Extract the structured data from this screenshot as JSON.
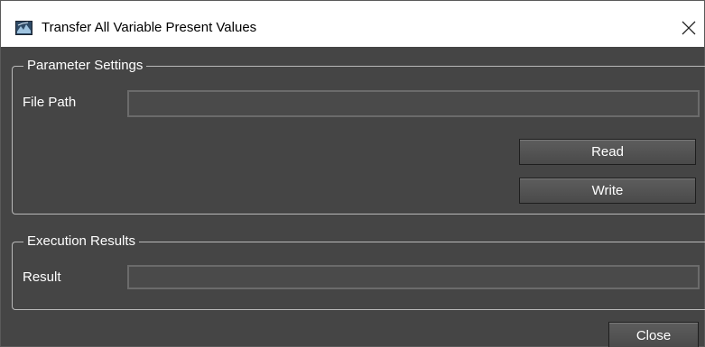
{
  "window": {
    "title": "Transfer All Variable Present Values",
    "icon": "app-icon",
    "close_icon": "close-icon"
  },
  "parameter_settings": {
    "legend": "Parameter Settings",
    "file_path_label": "File Path",
    "file_path_value": "",
    "read_label": "Read",
    "write_label": "Write"
  },
  "execution_results": {
    "legend": "Execution Results",
    "result_label": "Result",
    "result_value": ""
  },
  "footer": {
    "close_label": "Close"
  },
  "colors": {
    "background": "#454545",
    "titlebar": "#ffffff",
    "text": "#ffffff"
  }
}
